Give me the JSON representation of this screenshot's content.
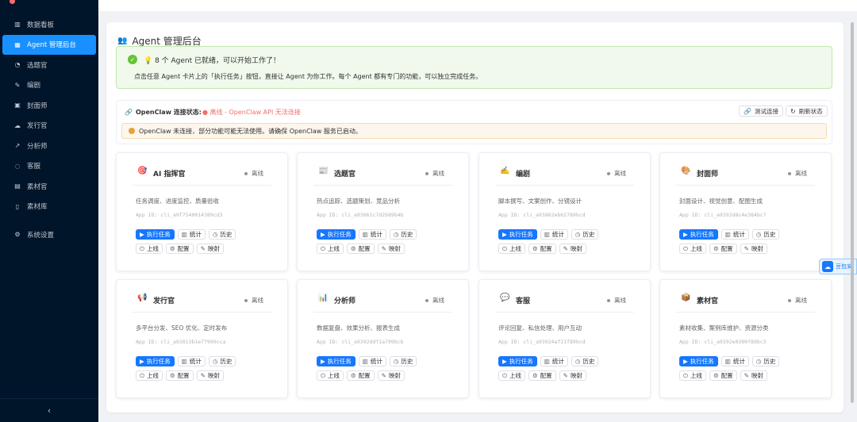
{
  "sidebar": {
    "items": [
      {
        "label": "数据看板",
        "icon": "chart-icon",
        "glyph": "▥"
      },
      {
        "label": "Agent 管理后台",
        "icon": "grid-icon",
        "glyph": "▦",
        "active": true
      },
      {
        "label": "选题官",
        "icon": "bulb-icon",
        "glyph": "◔"
      },
      {
        "label": "编剧",
        "icon": "pen-icon",
        "glyph": "✎"
      },
      {
        "label": "封面师",
        "icon": "image-icon",
        "glyph": "▣"
      },
      {
        "label": "发行官",
        "icon": "cloud-icon",
        "glyph": "☁"
      },
      {
        "label": "分析师",
        "icon": "trend-icon",
        "glyph": "↗"
      },
      {
        "label": "客服",
        "icon": "chat-icon",
        "glyph": "◌"
      },
      {
        "label": "素材官",
        "icon": "box-icon",
        "glyph": "▤"
      },
      {
        "label": "素材库",
        "icon": "doc-icon",
        "glyph": "▯"
      },
      {
        "label": "系统设置",
        "icon": "gear-icon",
        "glyph": "⚙"
      }
    ],
    "collapse_glyph": "‹"
  },
  "panel": {
    "title": "Agent 管理后台",
    "title_glyph": "👥"
  },
  "success_alert": {
    "line1": "💡 8 个 Agent 已就绪，可以开始工作了！",
    "line2": "点击任意 Agent 卡片上的「执行任务」按钮，直接让 Agent 为你工作。每个 Agent 都有专门的功能，可以独立完成任务。"
  },
  "openclaw": {
    "label": "OpenClaw 连接状态:",
    "status": "● 离线 - OpenClaw API 无法连接",
    "test_btn": "测试连接",
    "refresh_btn": "刷新状态",
    "warning": "OpenClaw 未连接，部分功能可能无法使用。请确保 OpenClaw 服务已启动。"
  },
  "buttons": {
    "run": "执行任务",
    "stats": "统计",
    "history": "历史",
    "online": "上线",
    "config": "配置",
    "mapping": "映射"
  },
  "agents": [
    {
      "name": "AI 指挥官",
      "glyph": "🎯",
      "status": "离线",
      "desc": "任务调度、进度监控、质量验收",
      "appid": "App ID: cli_a9f7540014389cd3"
    },
    {
      "name": "选题官",
      "glyph": "📰",
      "status": "离线",
      "desc": "热点追踪、选题策划、竞品分析",
      "appid": "App ID: cli_a93861c7d2b89b4b"
    },
    {
      "name": "编剧",
      "glyph": "✍️",
      "status": "离线",
      "desc": "脚本撰写、文案创作、分镜设计",
      "appid": "App ID: cli_a93862eb62789bcd"
    },
    {
      "name": "封面师",
      "glyph": "🎨",
      "status": "离线",
      "desc": "封面设计、视觉创意、配图生成",
      "appid": "App ID: cli_a9392d8c4e384bc7"
    },
    {
      "name": "发行官",
      "glyph": "📢",
      "status": "离线",
      "desc": "多平台分发、SEO 优化、定时发布",
      "appid": "App ID: cli_a93813b1e77990cca"
    },
    {
      "name": "分析师",
      "glyph": "📊",
      "status": "离线",
      "desc": "数据复盘、效果分析、报表生成",
      "appid": "App ID: cli_a9392ddf1a799bcb"
    },
    {
      "name": "客服",
      "glyph": "💬",
      "status": "离线",
      "desc": "评论回复、私信处理、用户互动",
      "appid": "App ID: cli_a93924af21f89bcd"
    },
    {
      "name": "素材官",
      "glyph": "📦",
      "status": "离线",
      "desc": "素材收集、案例库维护、资源分类",
      "appid": "App ID: cli_a9392e0390f89bc3"
    }
  ],
  "float_widget": {
    "text": "豆包安"
  }
}
